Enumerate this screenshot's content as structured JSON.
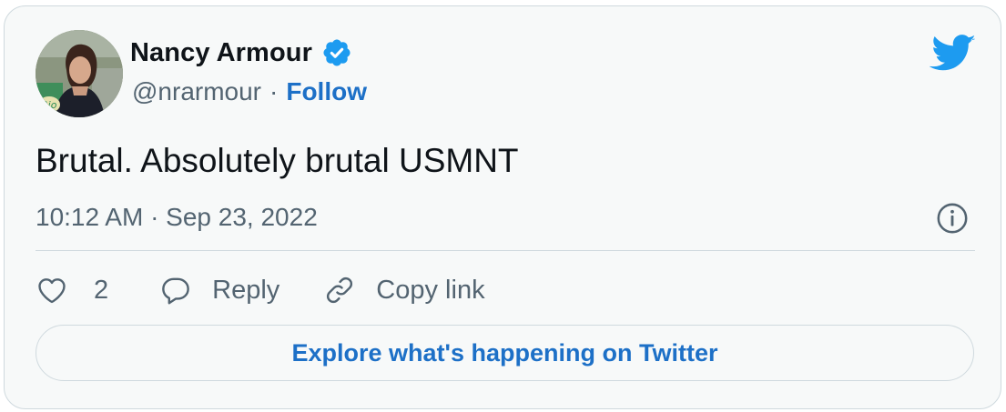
{
  "author": {
    "display_name": "Nancy Armour",
    "handle": "@nrarmour",
    "separator": "·",
    "follow_label": "Follow",
    "avatar_badge_text": "Rio"
  },
  "tweet": {
    "text": "Brutal. Absolutely brutal USMNT",
    "timestamp": "10:12 AM · Sep 23, 2022"
  },
  "actions": {
    "like_count": "2",
    "reply_label": "Reply",
    "copy_link_label": "Copy link"
  },
  "explore_label": "Explore what's happening on Twitter",
  "icons": {
    "twitter": "twitter-bird-icon",
    "verified": "verified-badge-icon",
    "info": "info-icon",
    "like": "heart-icon",
    "reply": "speech-bubble-icon",
    "copy_link": "link-icon"
  },
  "colors": {
    "accent": "#1d9bf0",
    "link": "#1d70c7",
    "secondary_text": "#536471",
    "card_background": "#f7f9f9",
    "border": "#cfd9de"
  }
}
